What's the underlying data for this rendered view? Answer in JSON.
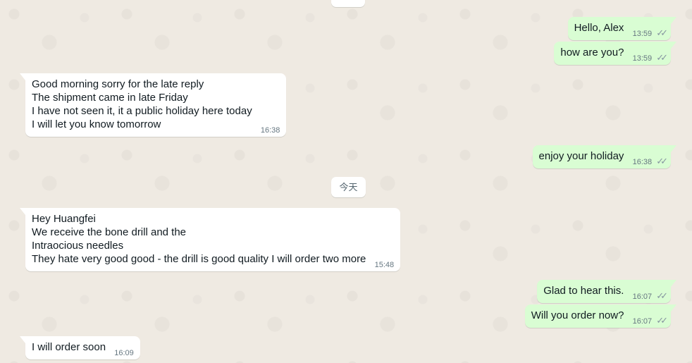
{
  "date_separator": "今天",
  "messages": [
    {
      "direction": "out",
      "lines": [
        "Hello, Alex"
      ],
      "time": "13:59",
      "status": "read-double-check"
    },
    {
      "direction": "out",
      "lines": [
        "how are you?"
      ],
      "time": "13:59",
      "status": "read-double-check"
    },
    {
      "direction": "in",
      "lines": [
        "Good morning sorry for the late reply",
        "The shipment came in late Friday",
        "I have not seen it, it a public holiday here today",
        "I will let you know tomorrow"
      ],
      "time": "16:38"
    },
    {
      "direction": "out",
      "lines": [
        "enjoy your holiday"
      ],
      "time": "16:38",
      "status": "read-double-check"
    },
    {
      "direction": "in",
      "lines": [
        "Hey Huangfei",
        "We receive the bone drill and the",
        "Intraocious needles",
        "They hate very good good - the drill is good quality I will order two more"
      ],
      "time": "15:48"
    },
    {
      "direction": "out",
      "lines": [
        "Glad to hear this."
      ],
      "time": "16:07",
      "status": "read-double-check"
    },
    {
      "direction": "out",
      "lines": [
        "Will you order now?"
      ],
      "time": "16:07",
      "status": "read-double-check"
    },
    {
      "direction": "in",
      "lines": [
        "I will order soon"
      ],
      "time": "16:09"
    }
  ]
}
